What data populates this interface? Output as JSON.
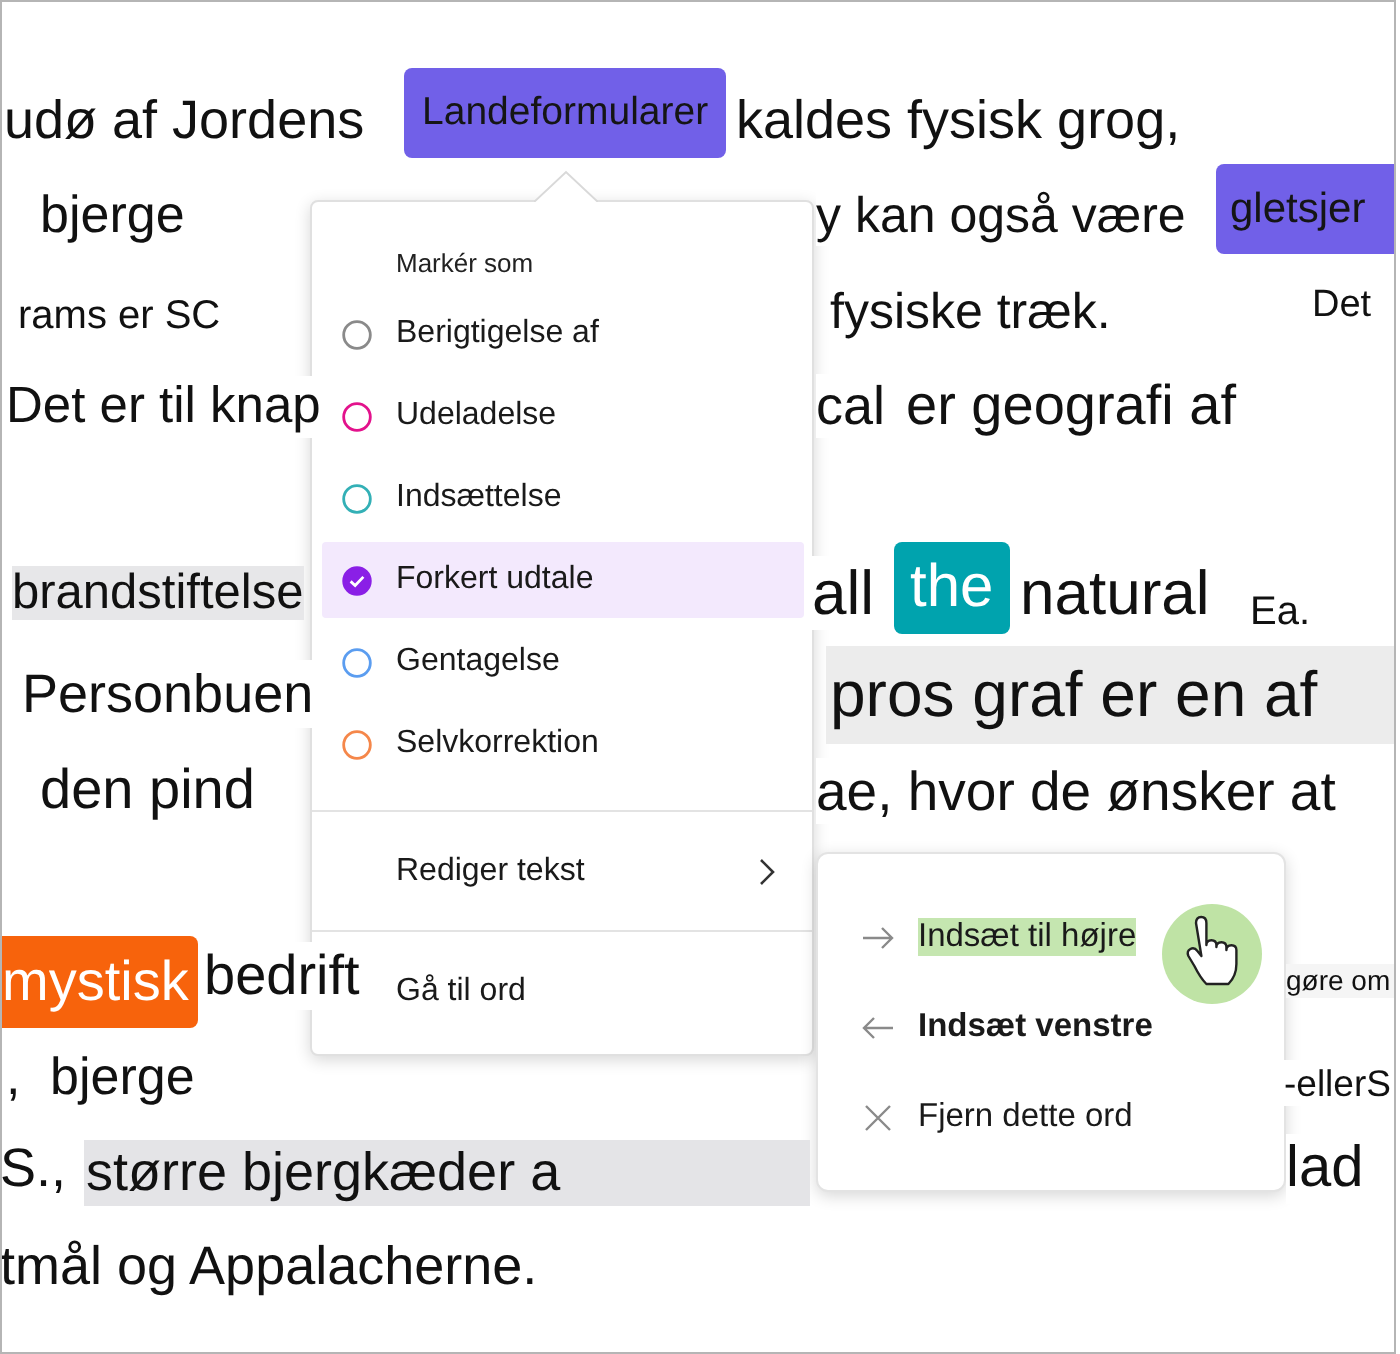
{
  "document": {
    "fragments": [
      {
        "text": "udø af Jordens",
        "kind": "plain"
      },
      {
        "text": "Landeformularer",
        "kind": "tag",
        "color": "#7160e8"
      },
      {
        "text": "kaldes fysisk grog,",
        "kind": "plain"
      },
      {
        "text": "bjerge",
        "kind": "plain"
      },
      {
        "text": "y kan også være",
        "kind": "plain"
      },
      {
        "text": "gletsjer",
        "kind": "tag",
        "color": "#7160e8"
      },
      {
        "text": "rams er SC",
        "kind": "plain"
      },
      {
        "text": "fysiske træk.",
        "kind": "plain"
      },
      {
        "text": "Det",
        "kind": "plain"
      },
      {
        "text": "Det er til knap",
        "kind": "plain"
      },
      {
        "text": "cal",
        "kind": "plain"
      },
      {
        "text": "er geografi af",
        "kind": "plain"
      },
      {
        "text": "brandstiftelse",
        "kind": "shaded"
      },
      {
        "text": "all",
        "kind": "plain"
      },
      {
        "text": "the",
        "kind": "highlight",
        "color": "#00a3ae"
      },
      {
        "text": "natural",
        "kind": "plain"
      },
      {
        "text": "Ea.",
        "kind": "plain"
      },
      {
        "text": "Personbuen",
        "kind": "plain"
      },
      {
        "text": "pros graf er en af",
        "kind": "shaded"
      },
      {
        "text": "den pind",
        "kind": "plain"
      },
      {
        "text": "ae, hvor de ønsker at",
        "kind": "plain"
      },
      {
        "text": "mystisk",
        "kind": "highlight",
        "color": "#f7630c"
      },
      {
        "text": "bedrift",
        "kind": "plain"
      },
      {
        "text": "gøre om",
        "kind": "plain"
      },
      {
        "text": ",",
        "kind": "plain"
      },
      {
        "text": "bjerge",
        "kind": "plain"
      },
      {
        "text": "-ellerS",
        "kind": "plain"
      },
      {
        "text": "S.,",
        "kind": "plain"
      },
      {
        "text": "større bjergkæder a",
        "kind": "shaded"
      },
      {
        "text": "lad",
        "kind": "plain"
      },
      {
        "text": "tmål og Appalacherne.",
        "kind": "plain"
      }
    ]
  },
  "mark_menu": {
    "heading": "Markér som",
    "options": [
      {
        "label": "Berigtigelse af",
        "color": "#8a8a8a",
        "selected": false
      },
      {
        "label": "Udeladelse",
        "color": "#e3128c",
        "selected": false
      },
      {
        "label": "Indsættelse",
        "color": "#33b0b6",
        "selected": false
      },
      {
        "label": "Forkert udtale",
        "color": "#8a1fe6",
        "selected": true
      },
      {
        "label": "Gentagelse",
        "color": "#5b9df0",
        "selected": false
      },
      {
        "label": "Selvkorrektion",
        "color": "#f5874a",
        "selected": false
      }
    ],
    "actions": [
      {
        "label": "Rediger tekst",
        "kind": "submenu"
      },
      {
        "label": "Gå til ord",
        "kind": "command"
      }
    ]
  },
  "edit_submenu": {
    "items": [
      {
        "label": "Indsæt til højre",
        "kind": "insert-right",
        "highlighted": true,
        "bold": false
      },
      {
        "label": "Indsæt venstre",
        "kind": "insert-left",
        "highlighted": false,
        "bold": true
      },
      {
        "label": "Fjern dette ord",
        "kind": "remove",
        "highlighted": false,
        "bold": false
      }
    ]
  }
}
